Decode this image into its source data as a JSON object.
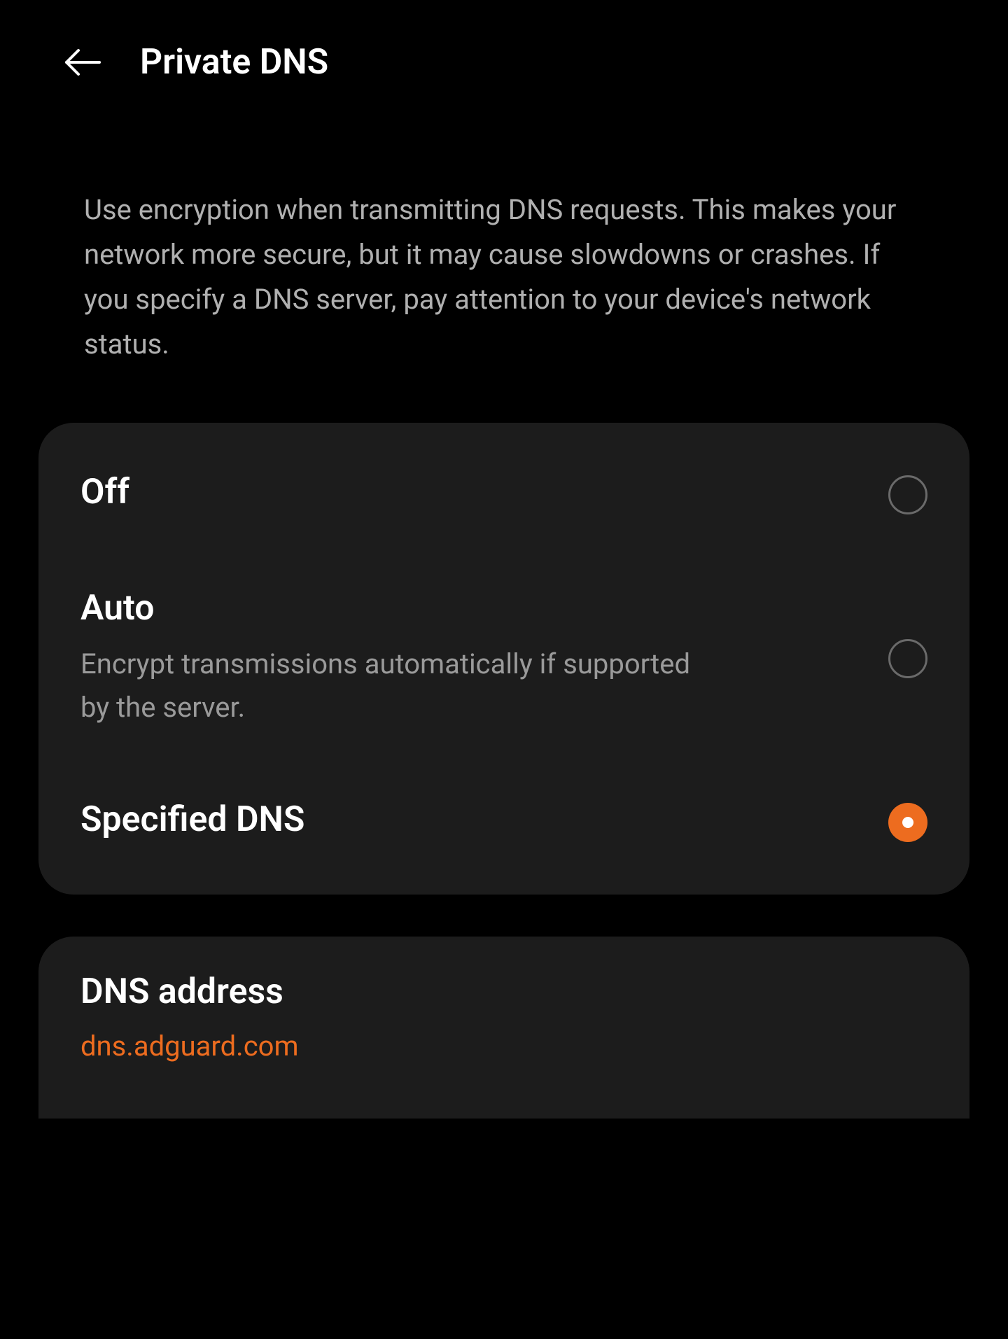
{
  "header": {
    "title": "Private DNS"
  },
  "description": "Use encryption when transmitting DNS requests. This makes your network more secure, but it may cause slowdowns or crashes. If you specify a DNS server, pay attention to your device's network status.",
  "options": [
    {
      "title": "Off",
      "subtitle": "",
      "selected": false
    },
    {
      "title": "Auto",
      "subtitle": "Encrypt transmissions automatically if supported by the server.",
      "selected": false
    },
    {
      "title": "Specified DNS",
      "subtitle": "",
      "selected": true
    }
  ],
  "dns": {
    "label": "DNS address",
    "value": "dns.adguard.com"
  },
  "colors": {
    "background": "#000000",
    "card": "#1c1c1c",
    "accent": "#ed6c1f",
    "textPrimary": "#ffffff",
    "textSecondary": "#b0b0b0"
  }
}
